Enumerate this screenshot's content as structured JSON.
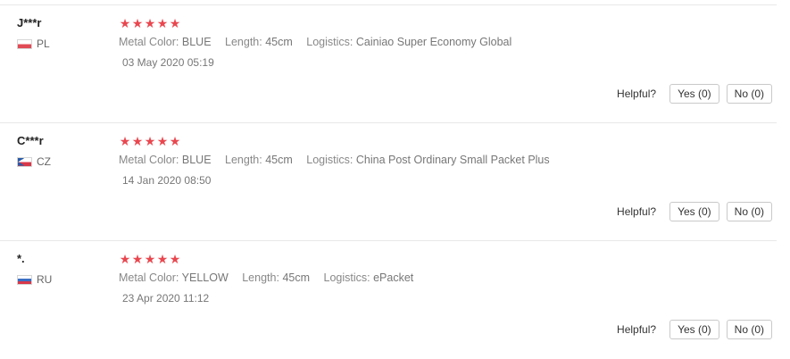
{
  "reviews": [
    {
      "user": "J***r",
      "country": "PL",
      "stars": 5,
      "attributes": [
        {
          "label": "Metal Color:",
          "value": "BLUE"
        },
        {
          "label": "Length:",
          "value": "45cm"
        },
        {
          "label": "Logistics:",
          "value": "Cainiao Super Economy Global"
        }
      ],
      "date": "03 May 2020 05:19",
      "helpful_label": "Helpful?",
      "yes_label": "Yes (0)",
      "no_label": "No (0)"
    },
    {
      "user": "C***r",
      "country": "CZ",
      "stars": 5,
      "attributes": [
        {
          "label": "Metal Color:",
          "value": "BLUE"
        },
        {
          "label": "Length:",
          "value": "45cm"
        },
        {
          "label": "Logistics:",
          "value": "China Post Ordinary Small Packet Plus"
        }
      ],
      "date": "14 Jan 2020 08:50",
      "helpful_label": "Helpful?",
      "yes_label": "Yes (0)",
      "no_label": "No (0)"
    },
    {
      "user": "*.",
      "country": "RU",
      "stars": 5,
      "attributes": [
        {
          "label": "Metal Color:",
          "value": "YELLOW"
        },
        {
          "label": "Length:",
          "value": "45cm"
        },
        {
          "label": "Logistics:",
          "value": "ePacket"
        }
      ],
      "date": "23 Apr 2020 11:12",
      "helpful_label": "Helpful?",
      "yes_label": "Yes (0)",
      "no_label": "No (0)"
    }
  ],
  "colors": {
    "star": "#e9474f",
    "divider": "#e8e8e8"
  }
}
